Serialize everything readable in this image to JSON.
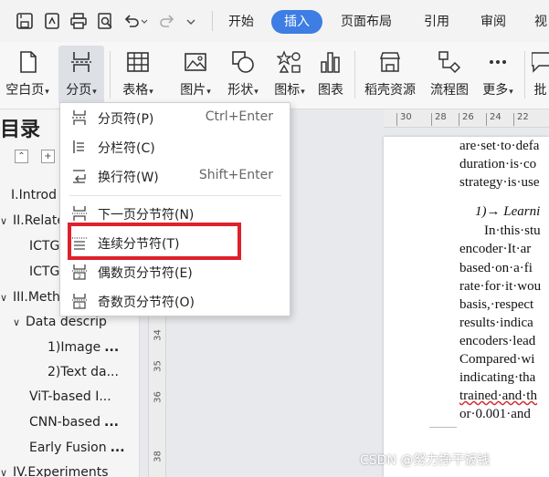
{
  "quick_access": {
    "icons": [
      "save-icon",
      "export-pdf-icon",
      "print-icon",
      "print-preview-icon",
      "undo-icon",
      "redo-icon",
      "customize-dropdown-icon"
    ]
  },
  "tabs": [
    {
      "label": "开始",
      "active": false
    },
    {
      "label": "插入",
      "active": true
    },
    {
      "label": "页面布局",
      "active": false
    },
    {
      "label": "引用",
      "active": false
    },
    {
      "label": "审阅",
      "active": false
    },
    {
      "label": "视",
      "active": false
    }
  ],
  "ribbon": {
    "blank_page": "空白页",
    "page_break": "分页",
    "table": "表格",
    "picture": "图片",
    "shape": "形状",
    "icon": "图标",
    "chart": "图表",
    "resources": "稻壳资源",
    "flowchart": "流程图",
    "more": "更多",
    "annotate": "批",
    "caret": "▾"
  },
  "nav": {
    "title": "目录",
    "items": [
      {
        "label": "I.Introd",
        "indent": 0
      },
      {
        "label": "II.Relate",
        "indent": 0,
        "arrow": "∨"
      },
      {
        "label": "ICTG",
        "indent": 1
      },
      {
        "label": "ICTG",
        "indent": 1
      },
      {
        "label": "III.Meth",
        "indent": 0,
        "arrow": "∨"
      },
      {
        "label": "Data descrip",
        "indent": 1,
        "arrow": "∨"
      },
      {
        "label": "1)Image",
        "indent": 2,
        "dots": "..."
      },
      {
        "label": "2)Text da...",
        "indent": 2
      },
      {
        "label": "ViT-based I...",
        "indent": 1
      },
      {
        "label": "CNN-based",
        "indent": 1,
        "dots": "..."
      },
      {
        "label": "Early Fusion",
        "indent": 1,
        "dots": "..."
      },
      {
        "label": "IV.Experiments",
        "indent": 0,
        "arrow": "∨"
      }
    ]
  },
  "menu": {
    "items": [
      {
        "label": "分页符(P)",
        "shortcut": "Ctrl+Enter",
        "icon": "page-break-icon"
      },
      {
        "label": "分栏符(C)",
        "shortcut": "",
        "icon": "column-break-icon"
      },
      {
        "label": "换行符(W)",
        "shortcut": "Shift+Enter",
        "icon": "line-break-icon"
      },
      {
        "label": "下一页分节符(N)",
        "shortcut": "",
        "icon": "next-page-section-icon"
      },
      {
        "label": "连续分节符(T)",
        "shortcut": "",
        "icon": "continuous-section-icon"
      },
      {
        "label": "偶数页分节符(E)",
        "shortcut": "",
        "icon": "even-page-section-icon"
      },
      {
        "label": "奇数页分节符(O)",
        "shortcut": "",
        "icon": "odd-page-section-icon"
      }
    ],
    "highlight_color": "#e0202a"
  },
  "hruler": {
    "labels": [
      "30",
      "28",
      "26",
      "24",
      "22"
    ]
  },
  "vruler": {
    "labels": [
      "34",
      "35",
      "36",
      "38"
    ]
  },
  "document": {
    "lines": [
      "are·set·to·defa",
      "duration·is·co",
      "strategy·is·use",
      "1)→ Learni",
      "In·this·stu",
      "encoder·It·ar",
      "based·on·a·fi",
      "rate·for·it·wou",
      "basis,·respect",
      "results·indica",
      "encoders·lead",
      "Compared·wi",
      "indicating·tha",
      "trained·and·th",
      "or·0.001·and"
    ]
  },
  "watermark": "CSDN @努力挣干饭钱",
  "colors": {
    "accent": "#3d7de4",
    "highlight": "#e0202a"
  }
}
